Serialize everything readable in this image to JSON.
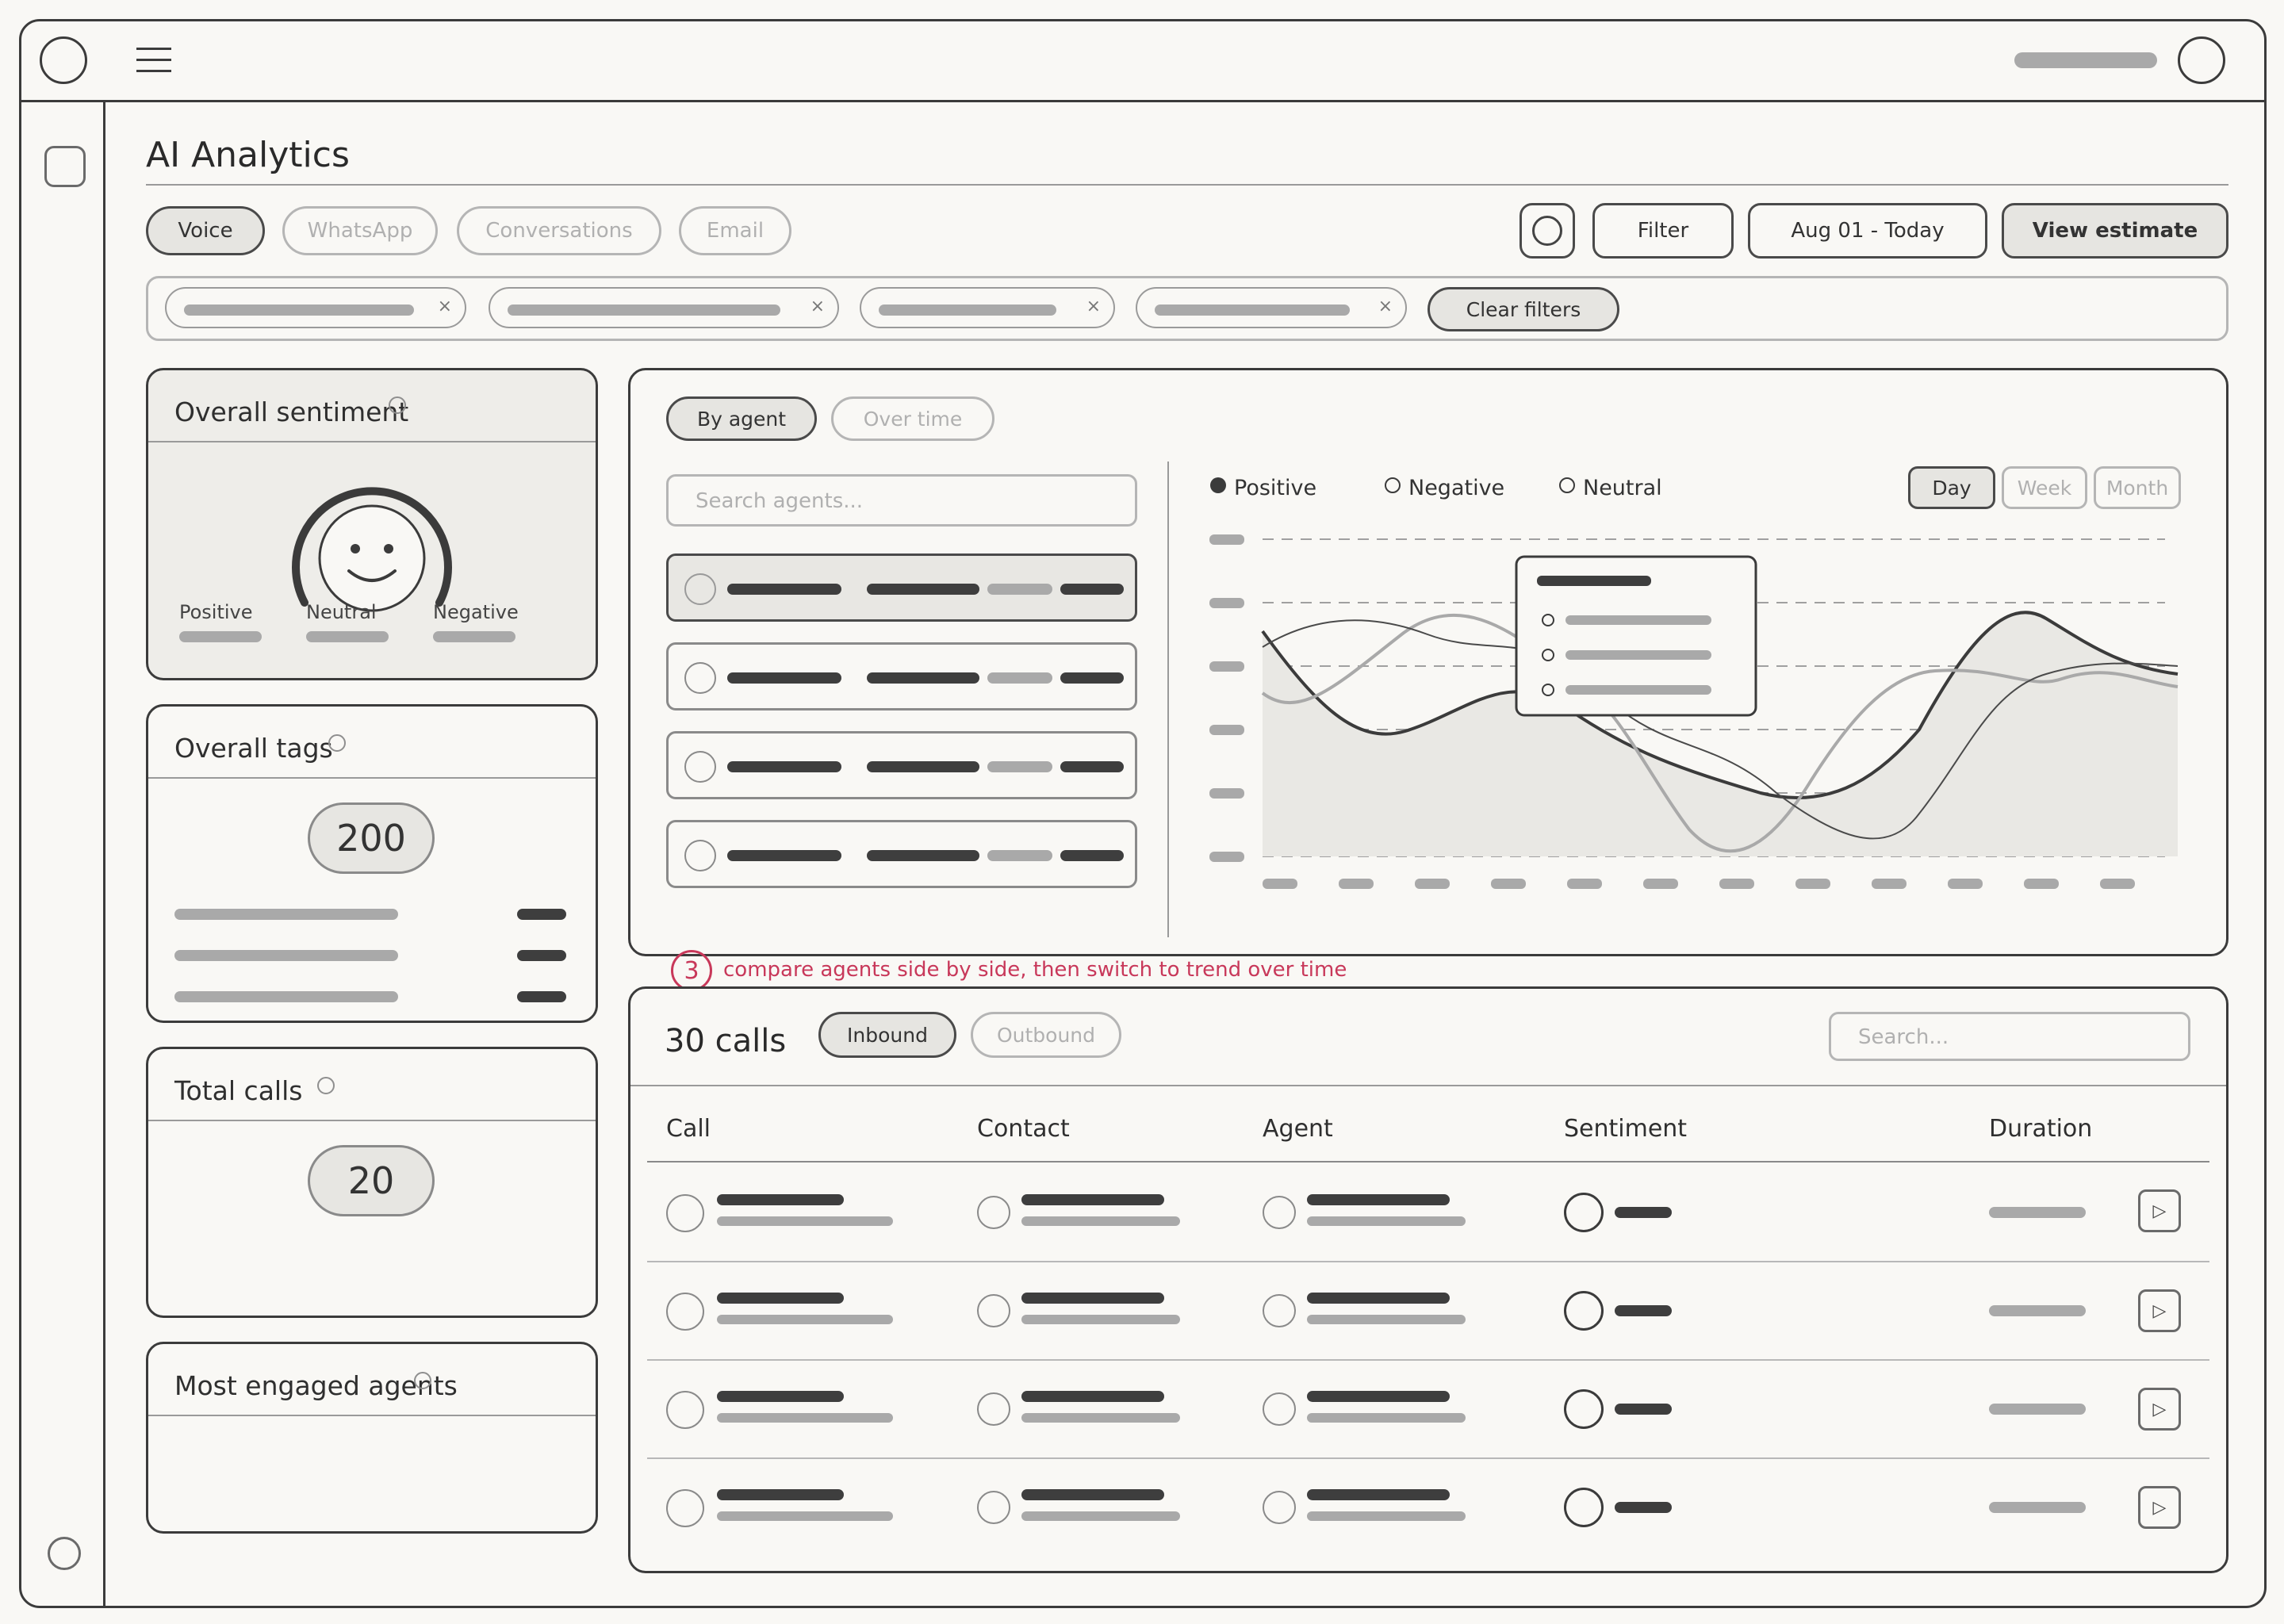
{
  "page": {
    "title": "AI Analytics"
  },
  "channels": [
    {
      "label": "Voice",
      "active": true
    },
    {
      "label": "WhatsApp",
      "active": false
    },
    {
      "label": "Conversations",
      "active": false
    },
    {
      "label": "Email",
      "active": false
    }
  ],
  "toolbar": {
    "filter_label": "Filter",
    "date_range": "Aug 01 - Today",
    "view_estimate_label": "View estimate"
  },
  "filters": {
    "chip_count": 4,
    "clear_label": "Clear filters"
  },
  "cards": {
    "sentiment": {
      "title": "Overall sentiment",
      "labels": [
        "Positive",
        "Neutral",
        "Negative"
      ]
    },
    "tags": {
      "title": "Overall tags",
      "value": "200"
    },
    "total_calls": {
      "title": "Total calls",
      "value": "20"
    },
    "engaged": {
      "title": "Most engaged agents"
    }
  },
  "agents_panel": {
    "tabs": [
      {
        "label": "By agent",
        "active": true
      },
      {
        "label": "Over time",
        "active": false
      }
    ],
    "search_placeholder": "Search agents...",
    "legend": [
      "Positive",
      "Negative",
      "Neutral"
    ],
    "granularity": [
      {
        "label": "Day",
        "active": true
      },
      {
        "label": "Week",
        "active": false
      },
      {
        "label": "Month",
        "active": false
      }
    ]
  },
  "annotation": {
    "number": "3",
    "text": "compare agents side by side, then switch to trend over time"
  },
  "calls": {
    "title": "30 calls",
    "tabs": [
      {
        "label": "Inbound",
        "active": true
      },
      {
        "label": "Outbound",
        "active": false
      }
    ],
    "search_placeholder": "Search...",
    "columns": [
      "Call",
      "Contact",
      "Agent",
      "Sentiment",
      "Duration"
    ],
    "row_count": 4
  },
  "colors": {
    "ink": "#3b3b3b",
    "accent": "#c8385a",
    "paper": "#f9f8f5"
  }
}
